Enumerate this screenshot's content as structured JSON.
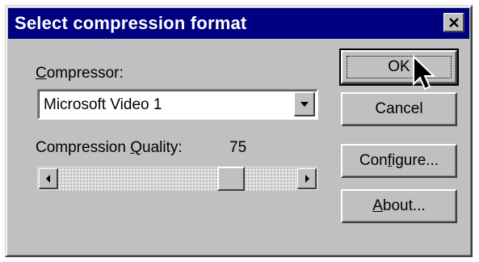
{
  "window": {
    "title": "Select compression format"
  },
  "compressor": {
    "label_mnemonic": "C",
    "label_rest": "ompressor:",
    "selected": "Microsoft Video 1"
  },
  "quality": {
    "label_before": "Compression ",
    "label_mnemonic": "Q",
    "label_after": "uality:",
    "value_text": "75",
    "value": 75,
    "min": 0,
    "max": 100
  },
  "buttons": {
    "ok": "OK",
    "cancel": "Cancel",
    "configure_before": "Con",
    "configure_mnemonic": "f",
    "configure_after": "igure...",
    "about_mnemonic": "A",
    "about_after": "bout..."
  },
  "icons": {
    "close": "close-icon",
    "dropdown": "chevron-down-icon",
    "left": "arrow-left-icon",
    "right": "arrow-right-icon",
    "cursor": "mouse-pointer-icon"
  },
  "colors": {
    "titlebar": "#000080",
    "face": "#c0c0c0"
  }
}
